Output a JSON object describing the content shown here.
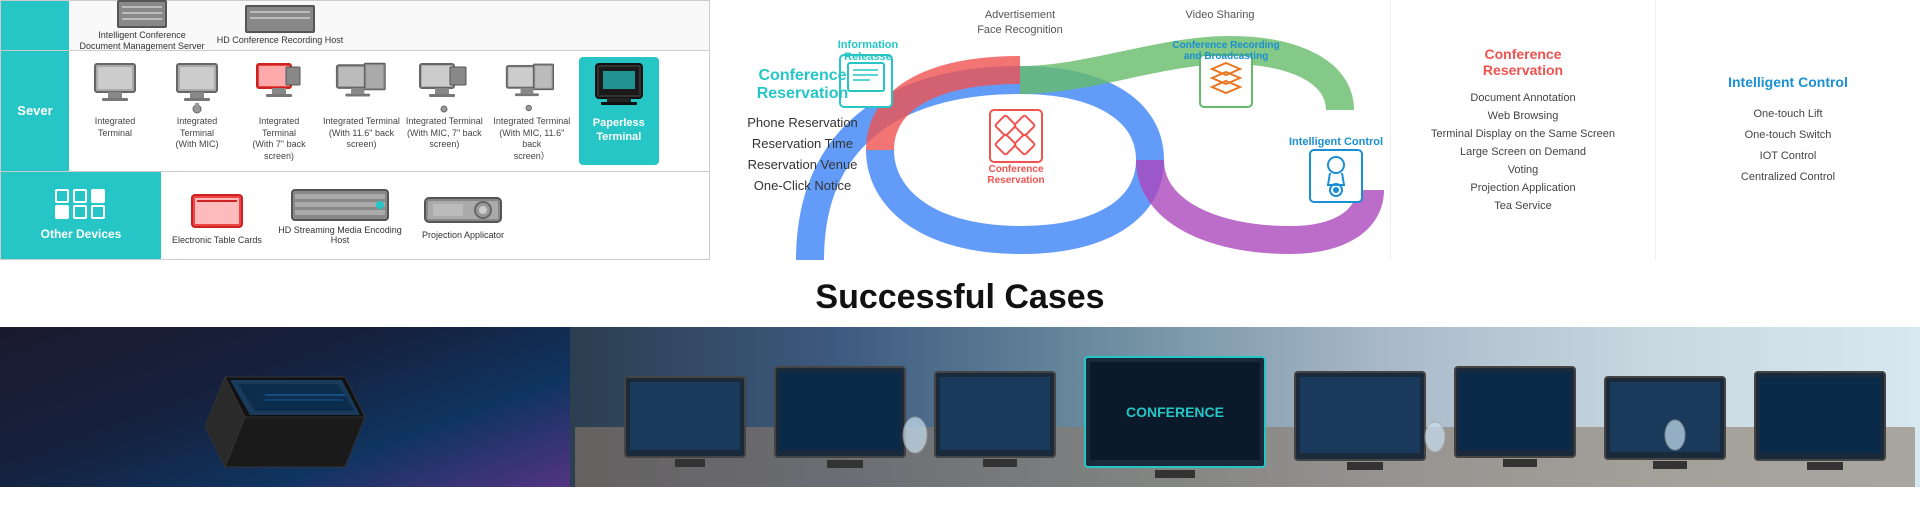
{
  "page": {
    "equipment_panel": {
      "server_label": "Sever",
      "server_devices": [
        {
          "label": "Integrated\nTerminal",
          "type": "monitor"
        },
        {
          "label": "Integrated\nTerminal\n(With MIC)",
          "type": "monitor-mic"
        },
        {
          "label": "Integrated\nTerminal\n(With 7\" back\nscreen)",
          "type": "monitor-small"
        },
        {
          "label": "Integrated Terminal\n(With 11.6\" back\nscreen)",
          "type": "monitor-large"
        },
        {
          "label": "Integrated Terminal\n(With MIC, 7\" back\nscreen)",
          "type": "monitor-mic-small"
        },
        {
          "label": "Integrated Terminal\n(With MIC, 11.6\" back\nscreen）",
          "type": "monitor-mic-large"
        },
        {
          "label": "Paperless\nTerminal",
          "type": "paperless",
          "active": true
        }
      ],
      "server_top_items": [
        {
          "label": "Intelligent Conference\nDocument Management\nServer",
          "type": "server"
        },
        {
          "label": "HD Conference Recording\nHost",
          "type": "box"
        }
      ],
      "other_label": "Other Devices",
      "other_devices": [
        {
          "label": "Electronic\nTable Cards",
          "type": "card"
        },
        {
          "label": "HD Streaming Media\nEncoding Host",
          "type": "server-box"
        },
        {
          "label": "Projection\nApplicator",
          "type": "projector"
        }
      ]
    },
    "diagram": {
      "left_title": "Conference Reservation",
      "left_items": [
        "Phone Reservation",
        "Reservation Time",
        "Reservation Venue",
        "One-Click Notice"
      ],
      "center_nodes": [
        {
          "label": "Information\nRelease",
          "color": "#26c6c6"
        },
        {
          "label": "Conference\nReservation",
          "color": "#e84040"
        }
      ],
      "top_items": [
        "Advertisement",
        "Face Recognition",
        "Video Sharing"
      ],
      "right_node": "Conference\nRecording\nand Broadcasting",
      "right_node_color": "#4caf50",
      "intelligent_control": "Intelligent Control"
    },
    "conf_reservation_panel": {
      "title": "Conference\nReservation",
      "title_color": "#e84040",
      "items": [
        "Document Annotation",
        "Web Browsing",
        "Terminal Display on the Same Screen",
        "Large Screen on Demand",
        "Voting",
        "Projection Application",
        "Tea Service"
      ]
    },
    "video_sharing_panel": {
      "title": "Conference Recording\nand Broadcasting",
      "title_color": "#4caf50",
      "items": []
    },
    "intelligent_control_panel": {
      "title": "Intelligent Control",
      "title_color": "#1a8fd1",
      "items": [
        "One-touch Lift",
        "One-touch Switch",
        "IOT Control",
        "Centralized Control"
      ]
    },
    "successful_cases": {
      "title": "Successful Cases"
    }
  }
}
